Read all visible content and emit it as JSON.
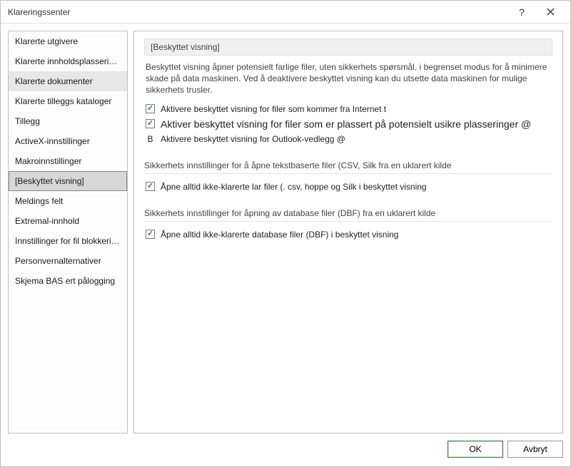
{
  "window": {
    "title": "Klareringssenter"
  },
  "sidebar": {
    "items": [
      {
        "label": "Klarerte utgivere"
      },
      {
        "label": "Klarerte innholdsplasseringer"
      },
      {
        "label": "Klarerte dokumenter"
      },
      {
        "label": "Klarerte tilleggs kataloger"
      },
      {
        "label": "Tillegg"
      },
      {
        "label": "ActiveX-innstillinger"
      },
      {
        "label": "Makroinnstillinger"
      },
      {
        "label": "[Beskyttet visning]"
      },
      {
        "label": "Meldings felt"
      },
      {
        "label": "Extremal-innhold"
      },
      {
        "label": "Innstillinger for fil blokkering"
      },
      {
        "label": "Personvernalternativer"
      },
      {
        "label": "Skjema BAS ert pålogging"
      }
    ],
    "selected_index": 7,
    "highlight_index": 2
  },
  "main": {
    "section1": {
      "title": "[Beskyttet visning]",
      "desc": "Beskyttet visning åpner potensielt farlige filer, uten sikkerhets spørsmål, i begrenset modus for å minimere skade på data maskinen. Ved å deaktivere beskyttet visning kan du utsette data maskinen for mulige sikkerhets trusler.",
      "opt1": "Aktivere beskyttet visning for filer som kommer fra Internet t",
      "opt2": "Aktiver beskyttet visning for filer som er plassert på potensielt usikre plasseringer @",
      "opt3_marker": "B",
      "opt3": "Aktivere beskyttet visning for Outlook-vedlegg @"
    },
    "section2": {
      "title": "Sikkerhets innstillinger for å åpne tekstbaserte filer (CSV, Silk fra en uklarert kilde",
      "opt1": "Åpne alltid ikke-klarerte lar filer (. csv, hoppe og Silk i beskyttet visning"
    },
    "section3": {
      "title": "Sikkerhets innstillinger for åpning av database filer (DBF) fra en uklarert kilde",
      "opt1": "Åpne alltid ikke-klarerte database filer (DBF) i beskyttet visning"
    }
  },
  "footer": {
    "ok": "OK",
    "cancel": "Avbryt"
  }
}
